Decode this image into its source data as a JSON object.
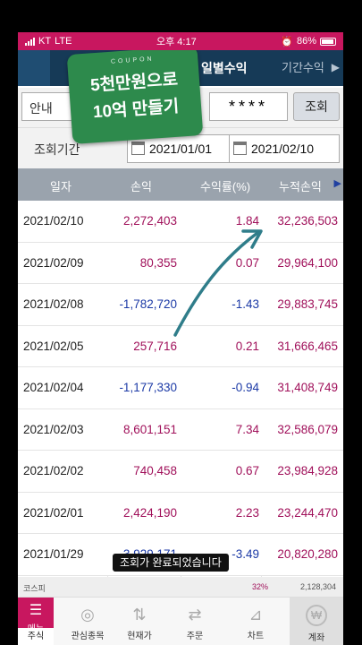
{
  "status": {
    "carrier": "KT",
    "network": "LTE",
    "time": "오후 4:17",
    "battery": "86%"
  },
  "header": {
    "tab_active": "일별수익",
    "tab_inactive": "기간수익"
  },
  "coupon": {
    "top": "COUPON",
    "line1": "5천만원으로",
    "line2": "10억 만들기"
  },
  "search": {
    "account_label": "안내",
    "password_mask": "****",
    "query_button": "조회"
  },
  "period": {
    "label": "조회기간",
    "from": "2021/01/01",
    "separator": "~",
    "to": "2021/02/10"
  },
  "table": {
    "headers": [
      "일자",
      "손익",
      "수익률(%)",
      "누적손익"
    ],
    "rows": [
      {
        "date": "2021/02/10",
        "pl": "2,272,403",
        "rate": "1.84",
        "cum": "32,236,503",
        "sign": "pos"
      },
      {
        "date": "2021/02/09",
        "pl": "80,355",
        "rate": "0.07",
        "cum": "29,964,100",
        "sign": "pos"
      },
      {
        "date": "2021/02/08",
        "pl": "-1,782,720",
        "rate": "-1.43",
        "cum": "29,883,745",
        "sign": "neg"
      },
      {
        "date": "2021/02/05",
        "pl": "257,716",
        "rate": "0.21",
        "cum": "31,666,465",
        "sign": "pos"
      },
      {
        "date": "2021/02/04",
        "pl": "-1,177,330",
        "rate": "-0.94",
        "cum": "31,408,749",
        "sign": "neg"
      },
      {
        "date": "2021/02/03",
        "pl": "8,601,151",
        "rate": "7.34",
        "cum": "32,586,079",
        "sign": "pos"
      },
      {
        "date": "2021/02/02",
        "pl": "740,458",
        "rate": "0.67",
        "cum": "23,984,928",
        "sign": "pos"
      },
      {
        "date": "2021/02/01",
        "pl": "2,424,190",
        "rate": "2.23",
        "cum": "23,244,470",
        "sign": "pos"
      },
      {
        "date": "2021/01/29",
        "pl": "-3,929,171",
        "rate": "-3.49",
        "cum": "20,820,280",
        "sign": "neg"
      }
    ]
  },
  "ticker": {
    "name": "코스피",
    "pct": "32%",
    "value": "2,128,304"
  },
  "toast": "조회가 완료되었습니다",
  "nav": {
    "menu": "메뉴",
    "stock": "주식",
    "watchlist": "관심종목",
    "price": "현재가",
    "order": "주문",
    "chart": "차트",
    "account": "계좌"
  },
  "colors": {
    "brand": "#c8175f",
    "positive": "#a0105a",
    "negative": "#1c3aa6",
    "header": "#163a57",
    "coupon": "#2d8a4c"
  }
}
